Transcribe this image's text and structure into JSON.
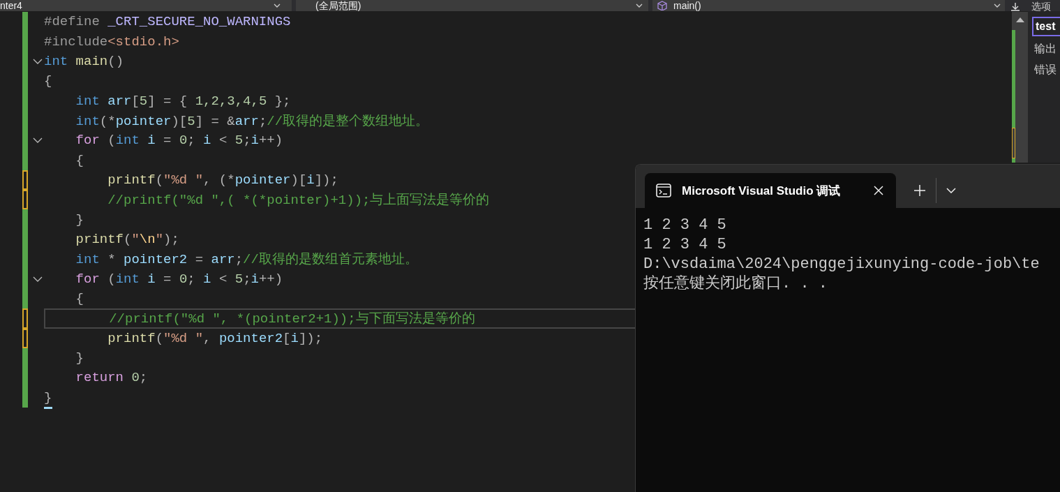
{
  "toolbar": {
    "project_dropdown": "nter4",
    "scope_dropdown": "(全局范围)",
    "member_dropdown": "main()"
  },
  "side_panel": {
    "header": "选项",
    "items": [
      {
        "label": "test",
        "selected": true
      },
      {
        "label": "输出",
        "selected": false
      },
      {
        "label": "错误",
        "selected": false
      }
    ]
  },
  "editor": {
    "lines": [
      {
        "modified": false,
        "fold": false,
        "current": false,
        "tokens": [
          {
            "kind": "pre",
            "text": "#define "
          },
          {
            "kind": "macro",
            "text": "_CRT_SECURE_NO_WARNINGS"
          }
        ]
      },
      {
        "modified": false,
        "fold": false,
        "current": false,
        "tokens": [
          {
            "kind": "pre",
            "text": "#include"
          },
          {
            "kind": "str",
            "text": "<stdio.h>"
          }
        ]
      },
      {
        "modified": false,
        "fold": true,
        "current": false,
        "tokens": [
          {
            "kind": "kw",
            "text": "int"
          },
          {
            "kind": "fn",
            "text": " main"
          },
          {
            "kind": "punct",
            "text": "()"
          }
        ]
      },
      {
        "modified": false,
        "fold": false,
        "current": false,
        "tokens": [
          {
            "kind": "punct",
            "text": "{"
          }
        ]
      },
      {
        "modified": false,
        "fold": false,
        "current": false,
        "tokens": [
          {
            "kind": "kw",
            "text": "    int"
          },
          {
            "kind": "var",
            "text": " arr"
          },
          {
            "kind": "punct",
            "text": "["
          },
          {
            "kind": "num",
            "text": "5"
          },
          {
            "kind": "punct",
            "text": "] = { "
          },
          {
            "kind": "num",
            "text": "1,2,3,4,5"
          },
          {
            "kind": "punct",
            "text": " };"
          }
        ]
      },
      {
        "modified": false,
        "fold": false,
        "current": false,
        "tokens": [
          {
            "kind": "kw",
            "text": "    int"
          },
          {
            "kind": "punct",
            "text": "(*"
          },
          {
            "kind": "var",
            "text": "pointer"
          },
          {
            "kind": "punct",
            "text": ")["
          },
          {
            "kind": "num",
            "text": "5"
          },
          {
            "kind": "punct",
            "text": "] = &"
          },
          {
            "kind": "var",
            "text": "arr"
          },
          {
            "kind": "punct",
            "text": ";"
          },
          {
            "kind": "comment",
            "text": "//取得的是整个数组地址。"
          }
        ]
      },
      {
        "modified": false,
        "fold": true,
        "current": false,
        "tokens": [
          {
            "kind": "ctrl",
            "text": "    for"
          },
          {
            "kind": "punct",
            "text": " ("
          },
          {
            "kind": "kw",
            "text": "int"
          },
          {
            "kind": "var",
            "text": " i"
          },
          {
            "kind": "punct",
            "text": " = "
          },
          {
            "kind": "num",
            "text": "0"
          },
          {
            "kind": "punct",
            "text": "; "
          },
          {
            "kind": "var",
            "text": "i"
          },
          {
            "kind": "punct",
            "text": " < "
          },
          {
            "kind": "num",
            "text": "5"
          },
          {
            "kind": "punct",
            "text": ";"
          },
          {
            "kind": "var",
            "text": "i"
          },
          {
            "kind": "punct",
            "text": "++)"
          }
        ]
      },
      {
        "modified": false,
        "fold": false,
        "current": false,
        "tokens": [
          {
            "kind": "punct",
            "text": "    {"
          }
        ]
      },
      {
        "modified": true,
        "fold": false,
        "current": false,
        "tokens": [
          {
            "kind": "fn",
            "text": "        printf"
          },
          {
            "kind": "punct",
            "text": "("
          },
          {
            "kind": "str",
            "text": "\"%d \""
          },
          {
            "kind": "punct",
            "text": ", (*"
          },
          {
            "kind": "var",
            "text": "pointer"
          },
          {
            "kind": "punct",
            "text": ")["
          },
          {
            "kind": "var",
            "text": "i"
          },
          {
            "kind": "punct",
            "text": "]);"
          }
        ]
      },
      {
        "modified": true,
        "fold": false,
        "current": false,
        "tokens": [
          {
            "kind": "comment",
            "text": "        //printf(\"%d \",( *(*pointer)+1));与上面写法是等价的"
          }
        ]
      },
      {
        "modified": false,
        "fold": false,
        "current": false,
        "tokens": [
          {
            "kind": "punct",
            "text": "    }"
          }
        ]
      },
      {
        "modified": false,
        "fold": false,
        "current": false,
        "tokens": [
          {
            "kind": "fn",
            "text": "    printf"
          },
          {
            "kind": "punct",
            "text": "("
          },
          {
            "kind": "str",
            "text": "\""
          },
          {
            "kind": "esc",
            "text": "\\n"
          },
          {
            "kind": "str",
            "text": "\""
          },
          {
            "kind": "punct",
            "text": ");"
          }
        ]
      },
      {
        "modified": false,
        "fold": false,
        "current": false,
        "tokens": [
          {
            "kind": "kw",
            "text": "    int"
          },
          {
            "kind": "punct",
            "text": " * "
          },
          {
            "kind": "var",
            "text": "pointer2"
          },
          {
            "kind": "punct",
            "text": " = "
          },
          {
            "kind": "var",
            "text": "arr"
          },
          {
            "kind": "punct",
            "text": ";"
          },
          {
            "kind": "comment",
            "text": "//取得的是数组首元素地址。"
          }
        ]
      },
      {
        "modified": false,
        "fold": true,
        "current": false,
        "tokens": [
          {
            "kind": "ctrl",
            "text": "    for"
          },
          {
            "kind": "punct",
            "text": " ("
          },
          {
            "kind": "kw",
            "text": "int"
          },
          {
            "kind": "var",
            "text": " i"
          },
          {
            "kind": "punct",
            "text": " = "
          },
          {
            "kind": "num",
            "text": "0"
          },
          {
            "kind": "punct",
            "text": "; "
          },
          {
            "kind": "var",
            "text": "i"
          },
          {
            "kind": "punct",
            "text": " < "
          },
          {
            "kind": "num",
            "text": "5"
          },
          {
            "kind": "punct",
            "text": ";"
          },
          {
            "kind": "var",
            "text": "i"
          },
          {
            "kind": "punct",
            "text": "++)"
          }
        ]
      },
      {
        "modified": false,
        "fold": false,
        "current": false,
        "tokens": [
          {
            "kind": "punct",
            "text": "    {"
          }
        ]
      },
      {
        "modified": true,
        "fold": false,
        "current": true,
        "tokens": [
          {
            "kind": "comment",
            "text": "        //printf(\"%d \", *(pointer2+1));与下面写法是等价的"
          }
        ]
      },
      {
        "modified": true,
        "fold": false,
        "current": false,
        "tokens": [
          {
            "kind": "fn",
            "text": "        printf"
          },
          {
            "kind": "punct",
            "text": "("
          },
          {
            "kind": "str",
            "text": "\"%d \""
          },
          {
            "kind": "punct",
            "text": ", "
          },
          {
            "kind": "var",
            "text": "pointer2"
          },
          {
            "kind": "punct",
            "text": "["
          },
          {
            "kind": "var",
            "text": "i"
          },
          {
            "kind": "punct",
            "text": "]);"
          }
        ]
      },
      {
        "modified": false,
        "fold": false,
        "current": false,
        "tokens": [
          {
            "kind": "punct",
            "text": "    }"
          }
        ]
      },
      {
        "modified": false,
        "fold": false,
        "current": false,
        "tokens": [
          {
            "kind": "ctrl",
            "text": "    return"
          },
          {
            "kind": "num",
            "text": " 0"
          },
          {
            "kind": "punct",
            "text": ";"
          }
        ]
      },
      {
        "modified": false,
        "fold": false,
        "current": false,
        "tokens": [
          {
            "kind": "punct",
            "text": "}"
          }
        ]
      }
    ]
  },
  "console": {
    "title": "Microsoft Visual Studio 调试",
    "output": [
      "1 2 3 4 5",
      "1 2 3 4 5",
      "D:\\vsdaima\\2024\\penggejixunying-code-job\\te",
      "按任意键关闭此窗口. . ."
    ]
  }
}
